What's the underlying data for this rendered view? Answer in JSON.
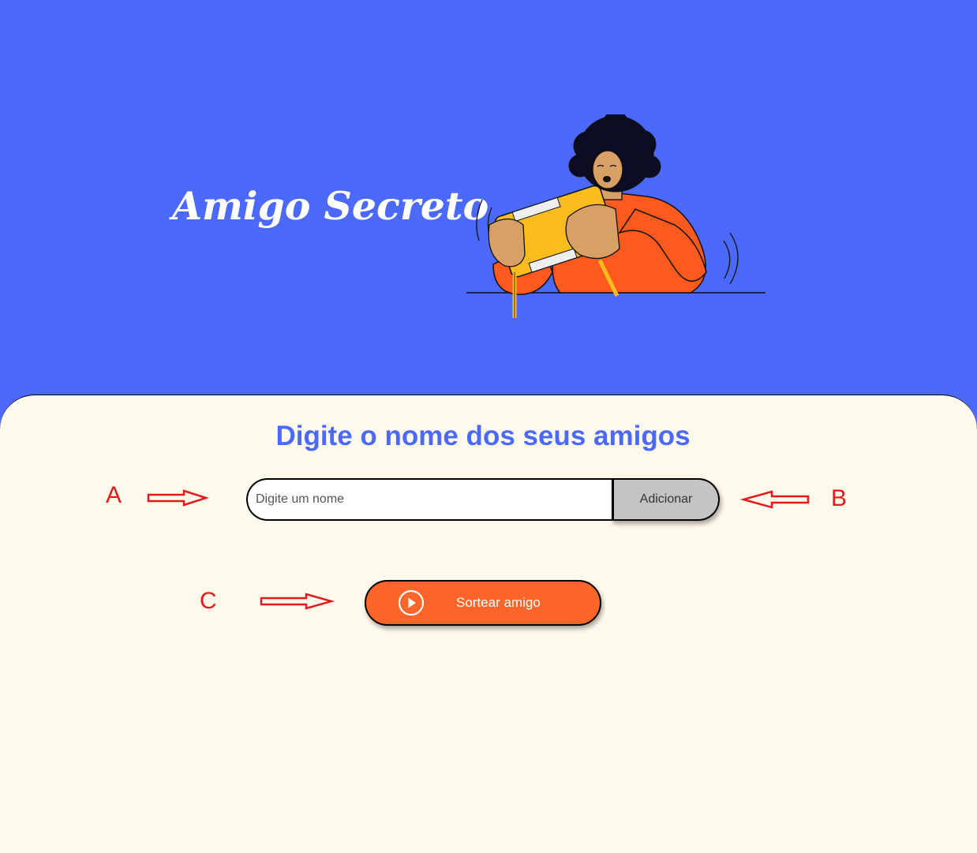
{
  "header": {
    "title": "Amigo Secreto",
    "illustration": "person-holding-game-console"
  },
  "main": {
    "subtitle": "Digite o nome dos seus amigos",
    "name_input": {
      "placeholder": "Digite um nome",
      "value": ""
    },
    "add_button_label": "Adicionar",
    "draw_button_label": "Sortear amigo",
    "draw_button_icon": "play-circle-icon"
  },
  "annotations": {
    "a": "A",
    "b": "B",
    "c": "C"
  },
  "colors": {
    "header_bg": "#4b69fd",
    "main_bg": "#fff9eb",
    "accent_blue": "#4b69fd",
    "draw_button": "#fe652b",
    "add_button": "#c4c4c4",
    "annotation_red": "#e01b1b"
  }
}
